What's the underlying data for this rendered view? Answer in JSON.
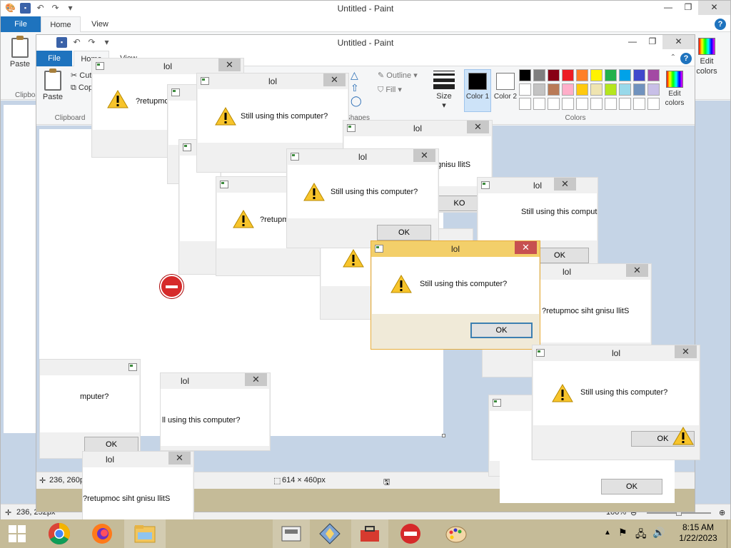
{
  "paint_back": {
    "title": "Untitled - Paint",
    "tabs": [
      "File",
      "Home",
      "View"
    ],
    "ribbon": {
      "paste": "Paste",
      "clipboard_group": "Clipboard",
      "edit_colors": "Edit colors"
    },
    "status": {
      "cursor": "236, 252px",
      "zoom": "100%"
    }
  },
  "paint_front": {
    "title": "Untitled - Paint",
    "tabs": [
      "File",
      "Home",
      "View"
    ],
    "ribbon": {
      "paste": "Paste",
      "cut": "Cut",
      "copy": "Copy",
      "clipboard_group": "Clipboard",
      "shapes_group": "Shapes",
      "outline": "Outline",
      "fill": "Fill",
      "size": "Size",
      "color1": "Color 1",
      "color2": "Color 2",
      "colors_group": "Colors",
      "edit_colors": "Edit colors"
    },
    "status": {
      "cursor": "236, 260px",
      "canvas_size": "614 × 460px"
    }
  },
  "palette_colors": [
    "#000000",
    "#7f7f7f",
    "#880015",
    "#ed1c24",
    "#ff7f27",
    "#fff200",
    "#22b14c",
    "#00a2e8",
    "#3f48cc",
    "#a349a4",
    "#ffffff",
    "#c3c3c3",
    "#b97a57",
    "#ffaec9",
    "#ffc90e",
    "#efe4b0",
    "#b5e61d",
    "#99d9ea",
    "#7092be",
    "#c8bfe7",
    "#ffffff",
    "#ffffff",
    "#ffffff",
    "#ffffff",
    "#ffffff",
    "#ffffff",
    "#ffffff",
    "#ffffff",
    "#ffffff",
    "#ffffff"
  ],
  "dialogs": [
    {
      "title": "lol",
      "message": "?retupmoc"
    },
    {
      "title": "lol",
      "message": "Still using this computer?"
    },
    {
      "title": "lol",
      "message": "Still using this computer?"
    },
    {
      "title": "lol",
      "message": "gnisu llitS",
      "button": "KO"
    },
    {
      "title": "lol",
      "message": "?retupmoc"
    },
    {
      "title": "lol",
      "message": "Still using this computer?",
      "button": "OK"
    },
    {
      "title": "lol",
      "message": "?retupmoc siht gnisu llitS",
      "button": "OK"
    },
    {
      "title": "lol",
      "message": "Still using this computer?",
      "button": "OK"
    },
    {
      "title": "lol",
      "message": "Still using this computer?",
      "button": "OK"
    },
    {
      "title": "lol",
      "message": "mputer?",
      "button": "OK"
    },
    {
      "title": "lol",
      "message": "ll using this computer?"
    },
    {
      "title": "lol",
      "message": "?retupmoc siht gnisu llitS"
    },
    {
      "title": "lol",
      "message": "Still using this computer?",
      "button": "OK"
    },
    {
      "title": "",
      "message": "",
      "button": "OK"
    }
  ],
  "taskbar": {
    "items": [
      "start-button",
      "chrome",
      "firefox",
      "file-explorer"
    ],
    "clock_time": "8:15 AM",
    "clock_date": "1/22/2023"
  }
}
